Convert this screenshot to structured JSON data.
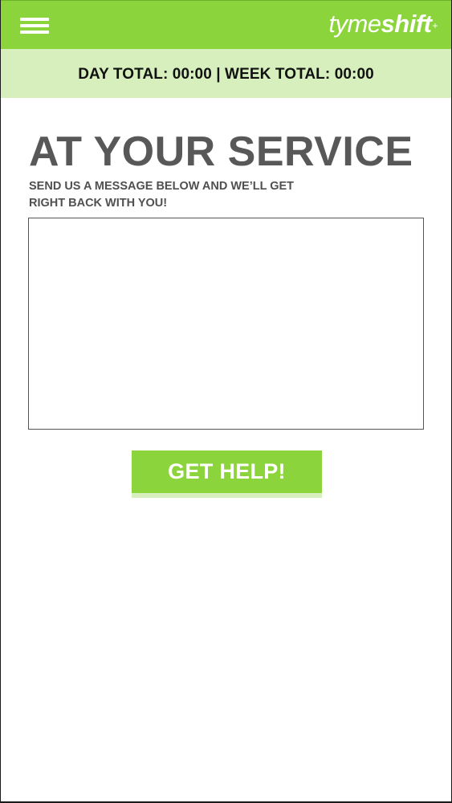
{
  "header": {
    "menu_icon": "hamburger-menu-icon",
    "logo": {
      "light": "tyme",
      "bold": "shift",
      "mark": "+"
    },
    "totals": "DAY TOTAL: 00:00 | WEEK TOTAL: 00:00"
  },
  "main": {
    "title": "AT YOUR SERVICE",
    "subtitle_line1": "SEND US A MESSAGE BELOW AND WE’LL GET",
    "subtitle_line2": "RIGHT BACK WITH YOU!",
    "message": {
      "value": "",
      "placeholder": ""
    },
    "submit_label": "GET HELP!"
  },
  "colors": {
    "brand_green": "#8cd43c",
    "light_green": "#d6efbd",
    "heading_gray": "#585858"
  }
}
